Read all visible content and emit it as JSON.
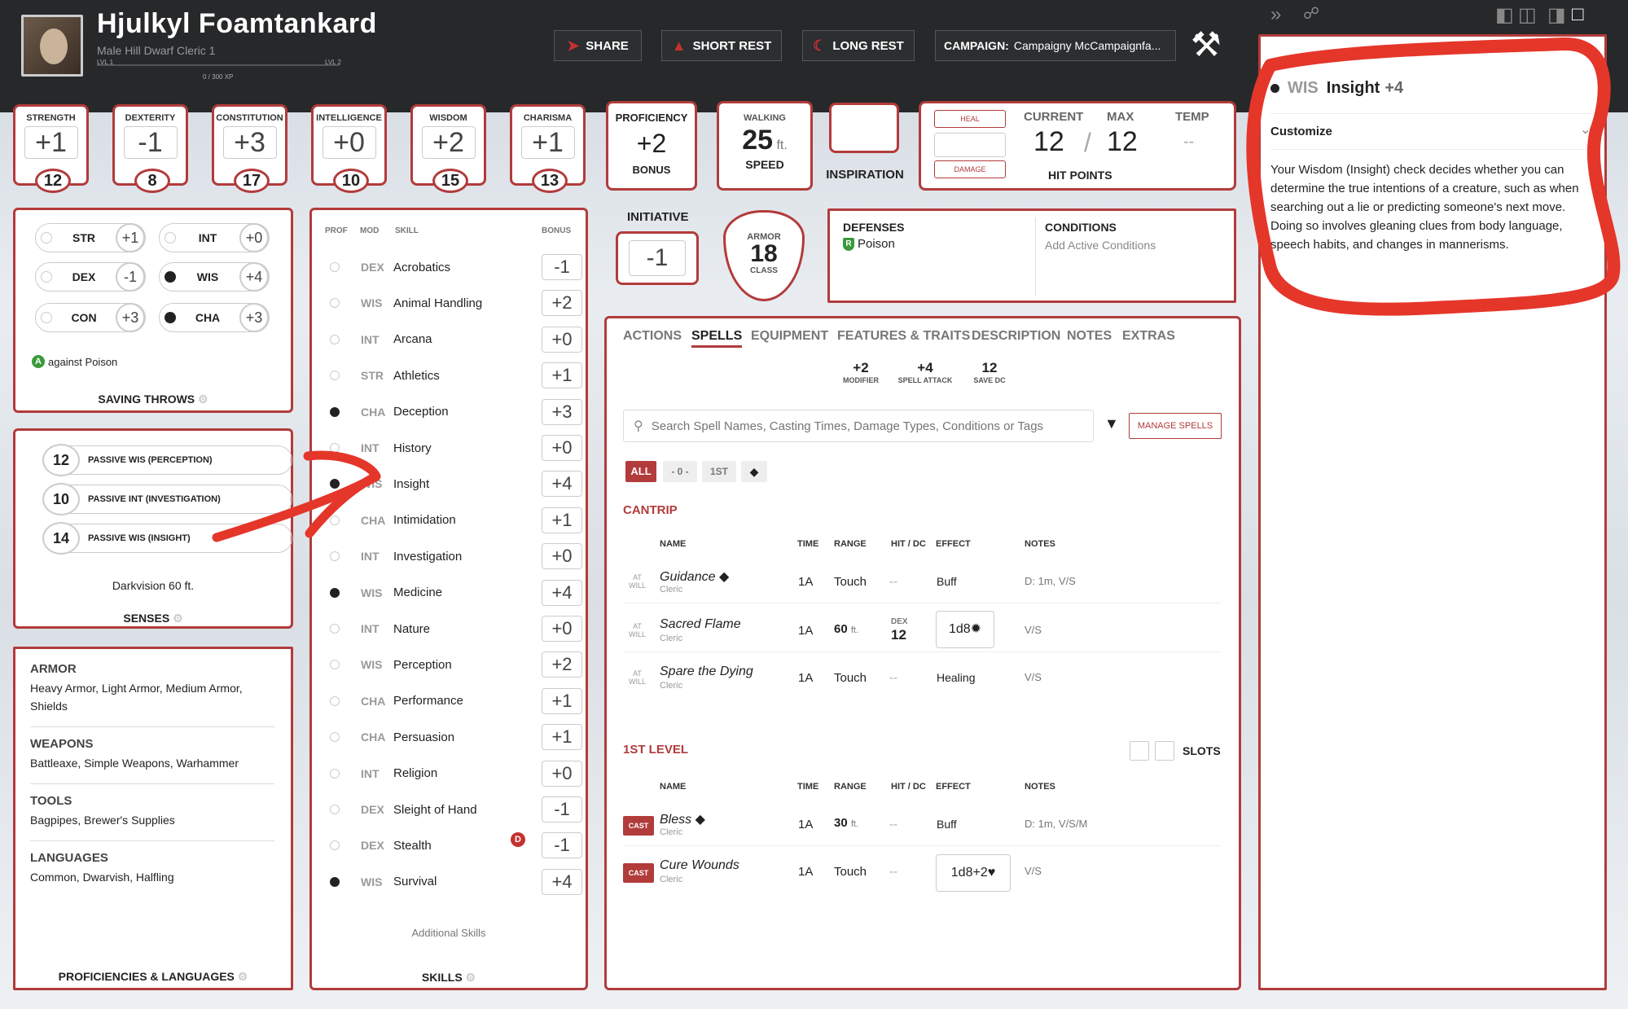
{
  "header": {
    "name": "Hjulkyl Foamtankard",
    "subtitle": "Male  Hill Dwarf  Cleric 1",
    "lvl1": "LVL 1",
    "lvl2": "LVL 2",
    "xp": "0 / 300 XP"
  },
  "buttons": {
    "share": "SHARE",
    "short_rest": "SHORT REST",
    "long_rest": "LONG REST",
    "campaign_label": "CAMPAIGN:",
    "campaign_name": "Campaigny McCampaignfa..."
  },
  "abilities": [
    {
      "name": "STRENGTH",
      "mod": "+1",
      "score": "12"
    },
    {
      "name": "DEXTERITY",
      "mod": "-1",
      "score": "8"
    },
    {
      "name": "CONSTITUTION",
      "mod": "+3",
      "score": "17"
    },
    {
      "name": "INTELLIGENCE",
      "mod": "+0",
      "score": "10"
    },
    {
      "name": "WISDOM",
      "mod": "+2",
      "score": "15"
    },
    {
      "name": "CHARISMA",
      "mod": "+1",
      "score": "13"
    }
  ],
  "proficiency": {
    "top": "PROFICIENCY",
    "value": "+2",
    "bottom": "BONUS"
  },
  "speed": {
    "top": "WALKING",
    "value": "25",
    "unit": "ft.",
    "bottom": "SPEED"
  },
  "inspiration": "INSPIRATION",
  "hp": {
    "heal": "HEAL",
    "damage": "DAMAGE",
    "current_label": "CURRENT",
    "max_label": "MAX",
    "temp_label": "TEMP",
    "current": "12",
    "max": "12",
    "temp": "--",
    "label": "HIT POINTS"
  },
  "saves": {
    "rows": [
      [
        "STR",
        "+1",
        "INT",
        "+0"
      ],
      [
        "DEX",
        "-1",
        "WIS",
        "+4"
      ],
      [
        "CON",
        "+3",
        "CHA",
        "+3"
      ]
    ],
    "note": "against Poison",
    "title": "SAVING THROWS"
  },
  "senses": {
    "rows": [
      [
        "12",
        "PASSIVE WIS (PERCEPTION)"
      ],
      [
        "10",
        "PASSIVE INT (INVESTIGATION)"
      ],
      [
        "14",
        "PASSIVE WIS (INSIGHT)"
      ]
    ],
    "darkvision": "Darkvision 60 ft.",
    "title": "SENSES"
  },
  "proficiencies": {
    "armor_h": "ARMOR",
    "armor": "Heavy Armor, Light Armor, Medium Armor, Shields",
    "weapons_h": "WEAPONS",
    "weapons": "Battleaxe, Simple Weapons, Warhammer",
    "tools_h": "TOOLS",
    "tools": "Bagpipes, Brewer's Supplies",
    "lang_h": "LANGUAGES",
    "lang": "Common, Dwarvish, Halfling",
    "title": "PROFICIENCIES & LANGUAGES"
  },
  "skills": {
    "headers": [
      "PROF",
      "MOD",
      "SKILL",
      "BONUS"
    ],
    "list": [
      {
        "mod": "DEX",
        "name": "Acrobatics",
        "bonus": "-1",
        "prof": false
      },
      {
        "mod": "WIS",
        "name": "Animal Handling",
        "bonus": "+2",
        "prof": false
      },
      {
        "mod": "INT",
        "name": "Arcana",
        "bonus": "+0",
        "prof": false
      },
      {
        "mod": "STR",
        "name": "Athletics",
        "bonus": "+1",
        "prof": false
      },
      {
        "mod": "CHA",
        "name": "Deception",
        "bonus": "+3",
        "prof": true
      },
      {
        "mod": "INT",
        "name": "History",
        "bonus": "+0",
        "prof": false
      },
      {
        "mod": "WIS",
        "name": "Insight",
        "bonus": "+4",
        "prof": true
      },
      {
        "mod": "CHA",
        "name": "Intimidation",
        "bonus": "+1",
        "prof": false
      },
      {
        "mod": "INT",
        "name": "Investigation",
        "bonus": "+0",
        "prof": false
      },
      {
        "mod": "WIS",
        "name": "Medicine",
        "bonus": "+4",
        "prof": true
      },
      {
        "mod": "INT",
        "name": "Nature",
        "bonus": "+0",
        "prof": false
      },
      {
        "mod": "WIS",
        "name": "Perception",
        "bonus": "+2",
        "prof": false
      },
      {
        "mod": "CHA",
        "name": "Performance",
        "bonus": "+1",
        "prof": false
      },
      {
        "mod": "CHA",
        "name": "Persuasion",
        "bonus": "+1",
        "prof": false
      },
      {
        "mod": "INT",
        "name": "Religion",
        "bonus": "+0",
        "prof": false
      },
      {
        "mod": "DEX",
        "name": "Sleight of Hand",
        "bonus": "-1",
        "prof": false
      },
      {
        "mod": "DEX",
        "name": "Stealth",
        "bonus": "-1",
        "prof": false
      },
      {
        "mod": "WIS",
        "name": "Survival",
        "bonus": "+4",
        "prof": true
      }
    ],
    "additional": "Additional Skills",
    "title": "SKILLS",
    "disadv": "D"
  },
  "initiative": {
    "label": "INITIATIVE",
    "value": "-1"
  },
  "armor": {
    "top": "ARMOR",
    "value": "18",
    "bottom": "CLASS"
  },
  "defenses": {
    "title": "DEFENSES",
    "item": "Poison",
    "cond_title": "CONDITIONS",
    "cond_add": "Add Active Conditions"
  },
  "tabs": [
    "ACTIONS",
    "SPELLS",
    "EQUIPMENT",
    "FEATURES & TRAITS",
    "DESCRIPTION",
    "NOTES",
    "EXTRAS"
  ],
  "spellstats": [
    {
      "v": "+2",
      "l": "MODIFIER"
    },
    {
      "v": "+4",
      "l": "SPELL ATTACK"
    },
    {
      "v": "12",
      "l": "SAVE DC"
    }
  ],
  "search": {
    "placeholder": "Search Spell Names, Casting Times, Damage Types, Conditions or Tags",
    "manage": "MANAGE SPELLS"
  },
  "filters": [
    "ALL",
    "- 0 -",
    "1ST"
  ],
  "cantrip": {
    "title": "CANTRIP",
    "headers": [
      "NAME",
      "TIME",
      "RANGE",
      "HIT / DC",
      "EFFECT",
      "NOTES"
    ],
    "at": "AT",
    "will": "WILL",
    "spells": [
      {
        "name": "Guidance",
        "cls": "Cleric",
        "time": "1A",
        "range": "Touch",
        "hit": "--",
        "effect": "Buff",
        "notes": "D: 1m, V/S"
      },
      {
        "name": "Sacred Flame",
        "cls": "Cleric",
        "time": "1A",
        "range": "60",
        "unit": "ft.",
        "hit_top": "DEX",
        "hit": "12",
        "effect": "1d8",
        "notes": "V/S"
      },
      {
        "name": "Spare the Dying",
        "cls": "Cleric",
        "time": "1A",
        "range": "Touch",
        "hit": "--",
        "effect": "Healing",
        "notes": "V/S"
      }
    ]
  },
  "level1": {
    "title": "1ST LEVEL",
    "slots": "SLOTS",
    "cast": "CAST",
    "spells": [
      {
        "name": "Bless",
        "cls": "Cleric",
        "time": "1A",
        "range": "30",
        "unit": "ft.",
        "hit": "--",
        "effect": "Buff",
        "notes": "D: 1m, V/S/M"
      },
      {
        "name": "Cure Wounds",
        "cls": "Cleric",
        "time": "1A",
        "range": "Touch",
        "hit": "--",
        "effect": "1d8+2",
        "notes": "V/S"
      }
    ]
  },
  "sidepanel": {
    "ability": "WIS",
    "skill": "Insight",
    "bonus": "+4",
    "customize": "Customize",
    "desc": "Your Wisdom (Insight) check decides whether you can determine the true intentions of a creature, such as when searching out a lie or predicting someone's next move. Doing so involves gleaning clues from body language, speech habits, and changes in mannerisms."
  },
  "colors": {
    "accent": "#b23b3b",
    "annotation": "#e5362a",
    "topbar": "#26282a"
  }
}
